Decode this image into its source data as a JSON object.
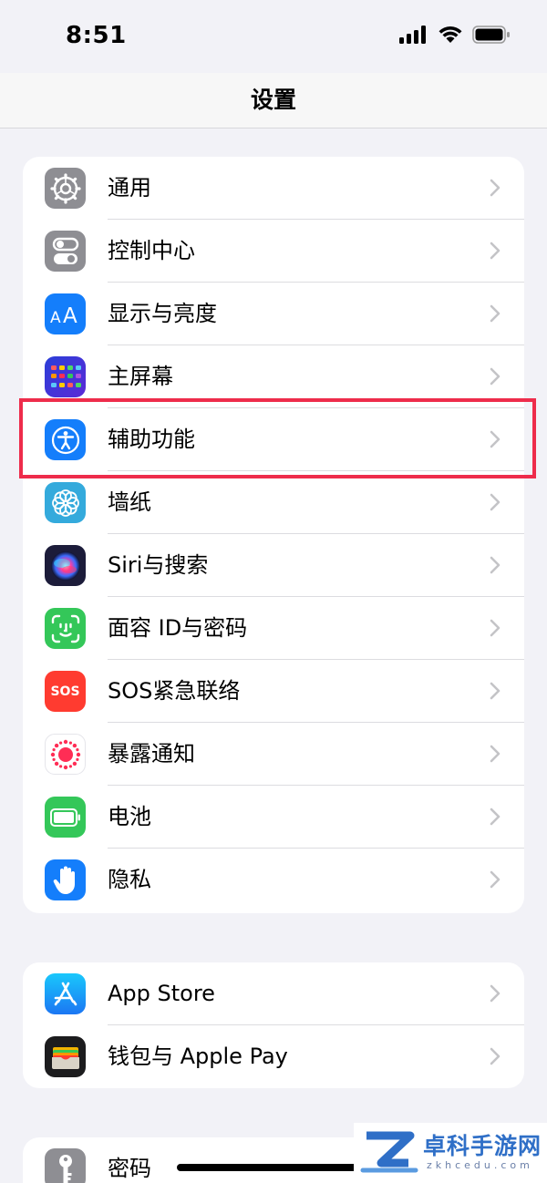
{
  "status_bar": {
    "time": "8:51"
  },
  "nav": {
    "title": "设置"
  },
  "groups": [
    {
      "items": [
        {
          "label": "通用",
          "icon": "gear-icon",
          "color": "#8e8e93"
        },
        {
          "label": "控制中心",
          "icon": "toggle-icon",
          "color": "#8e8e93"
        },
        {
          "label": "显示与亮度",
          "icon": "aa-text-icon",
          "color": "#147efb"
        },
        {
          "label": "主屏幕",
          "icon": "home-grid-icon",
          "color": "#2a3fd9"
        },
        {
          "label": "辅助功能",
          "icon": "accessibility-icon",
          "color": "#147efb"
        },
        {
          "label": "墙纸",
          "icon": "flower-icon",
          "color": "#34aadc"
        },
        {
          "label": "Siri与搜索",
          "icon": "siri-icon",
          "color": "#1c1c3a"
        },
        {
          "label": "面容 ID与密码",
          "icon": "face-id-icon",
          "color": "#34c759"
        },
        {
          "label": "SOS紧急联络",
          "icon": "sos-icon",
          "color": "#ff3b30",
          "icon_text": "SOS"
        },
        {
          "label": "暴露通知",
          "icon": "exposure-icon",
          "color": "#ff2d55"
        },
        {
          "label": "电池",
          "icon": "battery-icon",
          "color": "#34c759"
        },
        {
          "label": "隐私",
          "icon": "hand-icon",
          "color": "#147efb"
        }
      ]
    },
    {
      "items": [
        {
          "label": "App Store",
          "icon": "app-store-icon",
          "color": "#147efb"
        },
        {
          "label": "钱包与 Apple Pay",
          "icon": "wallet-icon",
          "color": "#1c1c1e"
        }
      ]
    },
    {
      "items": [
        {
          "label": "密码",
          "icon": "key-icon",
          "color": "#8e8e93"
        }
      ]
    }
  ],
  "highlighted_item": "辅助功能",
  "highlight_color": "#ee2c4b",
  "watermark": {
    "text": "卓科手游网",
    "sub": "zkhcedu.com"
  }
}
